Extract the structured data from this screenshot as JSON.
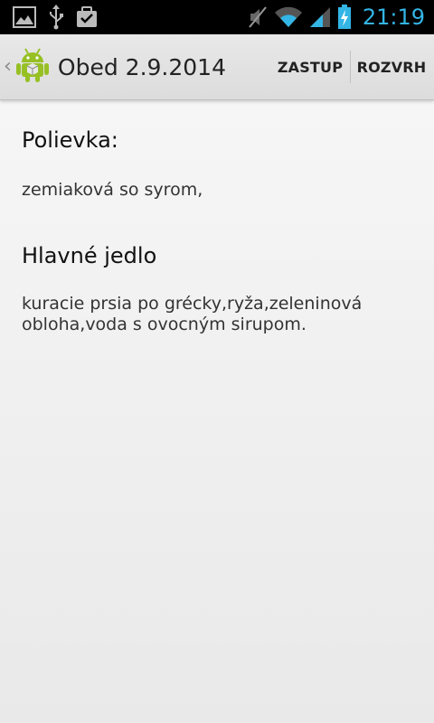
{
  "status_bar": {
    "time": "21:19",
    "clock_color": "#33b5e5",
    "left_icons": [
      "gallery-icon",
      "usb-icon",
      "task-check-icon"
    ],
    "right_icons": [
      "mute-icon",
      "wifi-icon",
      "signal-icon",
      "battery-charging-icon"
    ]
  },
  "action_bar": {
    "title": "Obed 2.9.2014",
    "app_icon": "android-icon",
    "actions": [
      "ZASTUP",
      "ROZVRH"
    ]
  },
  "sections": [
    {
      "heading": "Polievka:",
      "text": "zemiaková so syrom,"
    },
    {
      "heading": "Hlavné jedlo",
      "text": "kuracie prsia po grécky,ryža,zeleninová obloha,voda s ovocným sirupom."
    }
  ]
}
